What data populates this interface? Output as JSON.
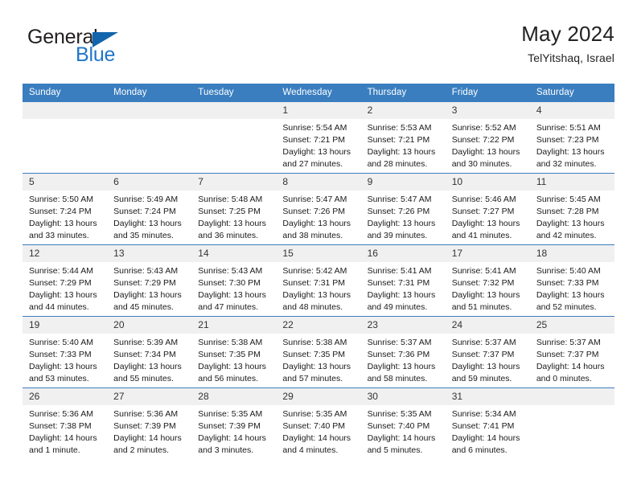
{
  "logo": {
    "word_top": "General",
    "word_bottom": "Blue",
    "triangle_color": "#1264ac",
    "blue_color": "#1f76c9",
    "dark_color": "#231f20"
  },
  "header": {
    "title": "May 2024",
    "subtitle": "TelYitshaq, Israel"
  },
  "theme": {
    "header_bg": "#3a7ebf",
    "daynum_bg": "#f0f0f0",
    "grid_line": "#3a7ebf"
  },
  "calendar": {
    "weekday_headers": [
      "Sunday",
      "Monday",
      "Tuesday",
      "Wednesday",
      "Thursday",
      "Friday",
      "Saturday"
    ],
    "weeks": [
      [
        {
          "day": "",
          "sunrise": "",
          "sunset": "",
          "daylight_1": "",
          "daylight_2": ""
        },
        {
          "day": "",
          "sunrise": "",
          "sunset": "",
          "daylight_1": "",
          "daylight_2": ""
        },
        {
          "day": "",
          "sunrise": "",
          "sunset": "",
          "daylight_1": "",
          "daylight_2": ""
        },
        {
          "day": "1",
          "sunrise": "Sunrise: 5:54 AM",
          "sunset": "Sunset: 7:21 PM",
          "daylight_1": "Daylight: 13 hours",
          "daylight_2": "and 27 minutes."
        },
        {
          "day": "2",
          "sunrise": "Sunrise: 5:53 AM",
          "sunset": "Sunset: 7:21 PM",
          "daylight_1": "Daylight: 13 hours",
          "daylight_2": "and 28 minutes."
        },
        {
          "day": "3",
          "sunrise": "Sunrise: 5:52 AM",
          "sunset": "Sunset: 7:22 PM",
          "daylight_1": "Daylight: 13 hours",
          "daylight_2": "and 30 minutes."
        },
        {
          "day": "4",
          "sunrise": "Sunrise: 5:51 AM",
          "sunset": "Sunset: 7:23 PM",
          "daylight_1": "Daylight: 13 hours",
          "daylight_2": "and 32 minutes."
        }
      ],
      [
        {
          "day": "5",
          "sunrise": "Sunrise: 5:50 AM",
          "sunset": "Sunset: 7:24 PM",
          "daylight_1": "Daylight: 13 hours",
          "daylight_2": "and 33 minutes."
        },
        {
          "day": "6",
          "sunrise": "Sunrise: 5:49 AM",
          "sunset": "Sunset: 7:24 PM",
          "daylight_1": "Daylight: 13 hours",
          "daylight_2": "and 35 minutes."
        },
        {
          "day": "7",
          "sunrise": "Sunrise: 5:48 AM",
          "sunset": "Sunset: 7:25 PM",
          "daylight_1": "Daylight: 13 hours",
          "daylight_2": "and 36 minutes."
        },
        {
          "day": "8",
          "sunrise": "Sunrise: 5:47 AM",
          "sunset": "Sunset: 7:26 PM",
          "daylight_1": "Daylight: 13 hours",
          "daylight_2": "and 38 minutes."
        },
        {
          "day": "9",
          "sunrise": "Sunrise: 5:47 AM",
          "sunset": "Sunset: 7:26 PM",
          "daylight_1": "Daylight: 13 hours",
          "daylight_2": "and 39 minutes."
        },
        {
          "day": "10",
          "sunrise": "Sunrise: 5:46 AM",
          "sunset": "Sunset: 7:27 PM",
          "daylight_1": "Daylight: 13 hours",
          "daylight_2": "and 41 minutes."
        },
        {
          "day": "11",
          "sunrise": "Sunrise: 5:45 AM",
          "sunset": "Sunset: 7:28 PM",
          "daylight_1": "Daylight: 13 hours",
          "daylight_2": "and 42 minutes."
        }
      ],
      [
        {
          "day": "12",
          "sunrise": "Sunrise: 5:44 AM",
          "sunset": "Sunset: 7:29 PM",
          "daylight_1": "Daylight: 13 hours",
          "daylight_2": "and 44 minutes."
        },
        {
          "day": "13",
          "sunrise": "Sunrise: 5:43 AM",
          "sunset": "Sunset: 7:29 PM",
          "daylight_1": "Daylight: 13 hours",
          "daylight_2": "and 45 minutes."
        },
        {
          "day": "14",
          "sunrise": "Sunrise: 5:43 AM",
          "sunset": "Sunset: 7:30 PM",
          "daylight_1": "Daylight: 13 hours",
          "daylight_2": "and 47 minutes."
        },
        {
          "day": "15",
          "sunrise": "Sunrise: 5:42 AM",
          "sunset": "Sunset: 7:31 PM",
          "daylight_1": "Daylight: 13 hours",
          "daylight_2": "and 48 minutes."
        },
        {
          "day": "16",
          "sunrise": "Sunrise: 5:41 AM",
          "sunset": "Sunset: 7:31 PM",
          "daylight_1": "Daylight: 13 hours",
          "daylight_2": "and 49 minutes."
        },
        {
          "day": "17",
          "sunrise": "Sunrise: 5:41 AM",
          "sunset": "Sunset: 7:32 PM",
          "daylight_1": "Daylight: 13 hours",
          "daylight_2": "and 51 minutes."
        },
        {
          "day": "18",
          "sunrise": "Sunrise: 5:40 AM",
          "sunset": "Sunset: 7:33 PM",
          "daylight_1": "Daylight: 13 hours",
          "daylight_2": "and 52 minutes."
        }
      ],
      [
        {
          "day": "19",
          "sunrise": "Sunrise: 5:40 AM",
          "sunset": "Sunset: 7:33 PM",
          "daylight_1": "Daylight: 13 hours",
          "daylight_2": "and 53 minutes."
        },
        {
          "day": "20",
          "sunrise": "Sunrise: 5:39 AM",
          "sunset": "Sunset: 7:34 PM",
          "daylight_1": "Daylight: 13 hours",
          "daylight_2": "and 55 minutes."
        },
        {
          "day": "21",
          "sunrise": "Sunrise: 5:38 AM",
          "sunset": "Sunset: 7:35 PM",
          "daylight_1": "Daylight: 13 hours",
          "daylight_2": "and 56 minutes."
        },
        {
          "day": "22",
          "sunrise": "Sunrise: 5:38 AM",
          "sunset": "Sunset: 7:35 PM",
          "daylight_1": "Daylight: 13 hours",
          "daylight_2": "and 57 minutes."
        },
        {
          "day": "23",
          "sunrise": "Sunrise: 5:37 AM",
          "sunset": "Sunset: 7:36 PM",
          "daylight_1": "Daylight: 13 hours",
          "daylight_2": "and 58 minutes."
        },
        {
          "day": "24",
          "sunrise": "Sunrise: 5:37 AM",
          "sunset": "Sunset: 7:37 PM",
          "daylight_1": "Daylight: 13 hours",
          "daylight_2": "and 59 minutes."
        },
        {
          "day": "25",
          "sunrise": "Sunrise: 5:37 AM",
          "sunset": "Sunset: 7:37 PM",
          "daylight_1": "Daylight: 14 hours",
          "daylight_2": "and 0 minutes."
        }
      ],
      [
        {
          "day": "26",
          "sunrise": "Sunrise: 5:36 AM",
          "sunset": "Sunset: 7:38 PM",
          "daylight_1": "Daylight: 14 hours",
          "daylight_2": "and 1 minute."
        },
        {
          "day": "27",
          "sunrise": "Sunrise: 5:36 AM",
          "sunset": "Sunset: 7:39 PM",
          "daylight_1": "Daylight: 14 hours",
          "daylight_2": "and 2 minutes."
        },
        {
          "day": "28",
          "sunrise": "Sunrise: 5:35 AM",
          "sunset": "Sunset: 7:39 PM",
          "daylight_1": "Daylight: 14 hours",
          "daylight_2": "and 3 minutes."
        },
        {
          "day": "29",
          "sunrise": "Sunrise: 5:35 AM",
          "sunset": "Sunset: 7:40 PM",
          "daylight_1": "Daylight: 14 hours",
          "daylight_2": "and 4 minutes."
        },
        {
          "day": "30",
          "sunrise": "Sunrise: 5:35 AM",
          "sunset": "Sunset: 7:40 PM",
          "daylight_1": "Daylight: 14 hours",
          "daylight_2": "and 5 minutes."
        },
        {
          "day": "31",
          "sunrise": "Sunrise: 5:34 AM",
          "sunset": "Sunset: 7:41 PM",
          "daylight_1": "Daylight: 14 hours",
          "daylight_2": "and 6 minutes."
        },
        {
          "day": "",
          "sunrise": "",
          "sunset": "",
          "daylight_1": "",
          "daylight_2": ""
        }
      ]
    ]
  }
}
